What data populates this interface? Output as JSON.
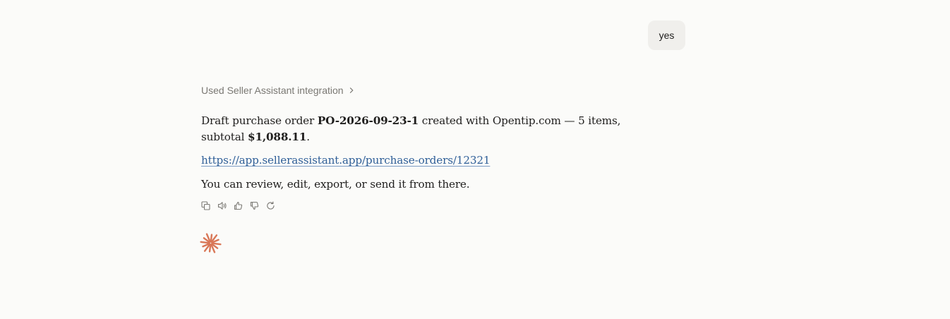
{
  "user_message": {
    "text": "yes"
  },
  "tool_use": {
    "label": "Used Seller Assistant integration"
  },
  "response": {
    "line1_prefix": "Draft purchase order ",
    "po_number": "PO-2026-09-23-1",
    "line1_middle": " created with Opentip.com — 5 items, subtotal ",
    "subtotal": "$1,088.11",
    "line1_suffix": ".",
    "link": "https://app.sellerassistant.app/purchase-orders/12321",
    "closing": "You can review, edit, export, or send it from there."
  },
  "actions": [
    {
      "icon": "copy-icon"
    },
    {
      "icon": "speaker-icon"
    },
    {
      "icon": "thumbs-up-icon"
    },
    {
      "icon": "thumbs-down-icon"
    },
    {
      "icon": "retry-icon"
    }
  ],
  "colors": {
    "background": "#fbfbf9",
    "user_bubble": "#f0efec",
    "link": "#2f5f98",
    "spark": "#d97757"
  }
}
